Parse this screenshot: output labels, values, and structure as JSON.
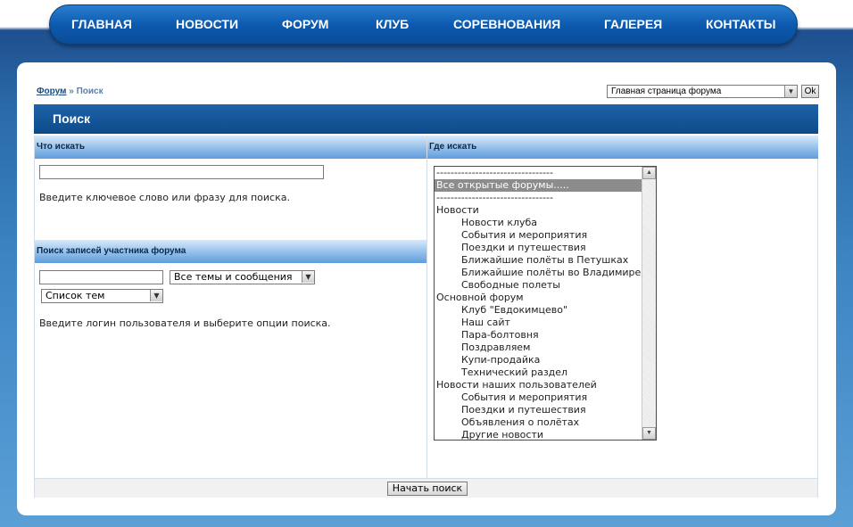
{
  "nav": {
    "items": [
      "ГЛАВНАЯ",
      "НОВОСТИ",
      "ФОРУМ",
      "КЛУБ",
      "СОРЕВНОВАНИЯ",
      "ГАЛЕРЕЯ",
      "КОНТАКТЫ"
    ]
  },
  "breadcrumb": {
    "forum": "Форум",
    "separator": "»",
    "current": "Поиск"
  },
  "jump": {
    "selected": "Главная страница форума",
    "ok_label": "Ok"
  },
  "page_title": "Поиск",
  "what": {
    "header": "Что искать",
    "keyword_value": "",
    "hint": "Введите ключевое слово или фразу для поиска."
  },
  "member": {
    "header": "Поиск записей участника форума",
    "user_value": "",
    "scope_selected": "Все темы и сообщения",
    "display_selected": "Список тем",
    "hint": "Введите логин пользователя и выберите опции поиска."
  },
  "where": {
    "header": "Где искать",
    "items": [
      {
        "label": "---------------------------------",
        "level": 0
      },
      {
        "label": "Все открытые форумы.....",
        "level": 0,
        "selected": true
      },
      {
        "label": "---------------------------------",
        "level": 0
      },
      {
        "label": "Новости",
        "level": 0
      },
      {
        "label": "Новости клуба",
        "level": 1
      },
      {
        "label": "События и мероприятия",
        "level": 1
      },
      {
        "label": "Поездки и путешествия",
        "level": 1
      },
      {
        "label": "Ближайшие полёты в Петушках",
        "level": 1
      },
      {
        "label": "Ближайшие полёты во Владимире",
        "level": 1
      },
      {
        "label": "Свободные полеты",
        "level": 1
      },
      {
        "label": "Основной форум",
        "level": 0
      },
      {
        "label": "Клуб \"Евдокимцево\"",
        "level": 1
      },
      {
        "label": "Наш сайт",
        "level": 1
      },
      {
        "label": "Пара-болтовня",
        "level": 1
      },
      {
        "label": "Поздравляем",
        "level": 1
      },
      {
        "label": "Купи-продайка",
        "level": 1
      },
      {
        "label": "Технический раздел",
        "level": 1
      },
      {
        "label": "Новости наших пользователей",
        "level": 0
      },
      {
        "label": "События и мероприятия",
        "level": 1
      },
      {
        "label": "Поездки и путешествия",
        "level": 1
      },
      {
        "label": "Объявления о полётах",
        "level": 1
      },
      {
        "label": "Другие новости",
        "level": 1
      }
    ]
  },
  "submit_label": "Начать поиск"
}
